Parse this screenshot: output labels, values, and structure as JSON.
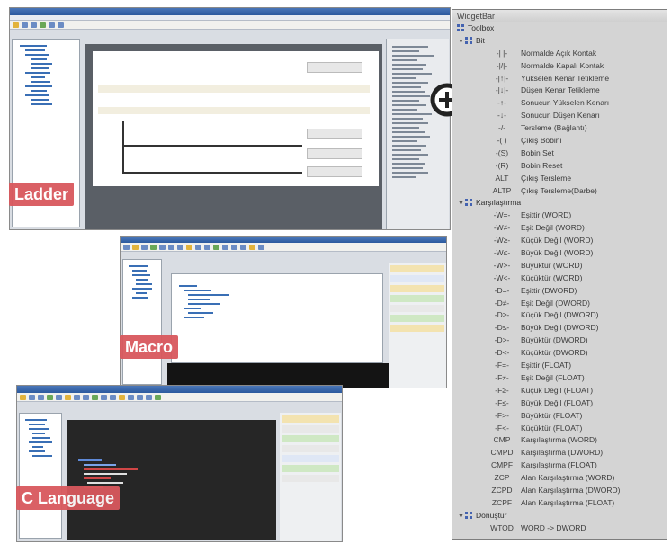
{
  "labels": {
    "ladder": "Ladder",
    "macro": "Macro",
    "c_language": "C Language"
  },
  "widgetbar": {
    "title": "WidgetBar",
    "toolbox_label": "Toolbox",
    "sections": [
      {
        "label": "Bit",
        "items": [
          {
            "sym": "-| |-",
            "desc": "Normalde Açık Kontak"
          },
          {
            "sym": "-|/|-",
            "desc": "Normalde Kapalı Kontak"
          },
          {
            "sym": "-|↑|-",
            "desc": "Yükselen Kenar Tetikleme"
          },
          {
            "sym": "-|↓|-",
            "desc": "Düşen Kenar Tetikleme"
          },
          {
            "sym": "-↑-",
            "desc": "Sonucun Yükselen Kenarı"
          },
          {
            "sym": "-↓-",
            "desc": "Sonucun Düşen Kenarı"
          },
          {
            "sym": "-/-",
            "desc": "Tersleme (Bağlantı)"
          },
          {
            "sym": "-( )",
            "desc": "Çıkış Bobini"
          },
          {
            "sym": "-(S)",
            "desc": "Bobin Set"
          },
          {
            "sym": "-(R)",
            "desc": "Bobin Reset"
          },
          {
            "sym": "ALT",
            "desc": "Çıkış Tersleme"
          },
          {
            "sym": "ALTP",
            "desc": "Çıkış Tersleme(Darbe)"
          }
        ]
      },
      {
        "label": "Karşılaştırma",
        "items": [
          {
            "sym": "-W=-",
            "desc": "Eşittir (WORD)"
          },
          {
            "sym": "-W≠-",
            "desc": "Eşit Değil (WORD)"
          },
          {
            "sym": "-W≥-",
            "desc": "Küçük Değil (WORD)"
          },
          {
            "sym": "-W≤-",
            "desc": "Büyük Değil (WORD)"
          },
          {
            "sym": "-W>-",
            "desc": "Büyüktür (WORD)"
          },
          {
            "sym": "-W<-",
            "desc": "Küçüktür (WORD)"
          },
          {
            "sym": "-D=-",
            "desc": "Eşittir (DWORD)"
          },
          {
            "sym": "-D≠-",
            "desc": "Eşit Değil (DWORD)"
          },
          {
            "sym": "-D≥-",
            "desc": "Küçük Değil (DWORD)"
          },
          {
            "sym": "-D≤-",
            "desc": "Büyük Değil (DWORD)"
          },
          {
            "sym": "-D>-",
            "desc": "Büyüktür (DWORD)"
          },
          {
            "sym": "-D<-",
            "desc": "Küçüktür (DWORD)"
          },
          {
            "sym": "-F=-",
            "desc": "Eşittir (FLOAT)"
          },
          {
            "sym": "-F≠-",
            "desc": "Eşit Değil (FLOAT)"
          },
          {
            "sym": "-F≥-",
            "desc": "Küçük Değil (FLOAT)"
          },
          {
            "sym": "-F≤-",
            "desc": "Büyük Değil (FLOAT)"
          },
          {
            "sym": "-F>-",
            "desc": "Büyüktür (FLOAT)"
          },
          {
            "sym": "-F<-",
            "desc": "Küçüktür (FLOAT)"
          },
          {
            "sym": "CMP",
            "desc": "Karşılaştırma (WORD)"
          },
          {
            "sym": "CMPD",
            "desc": "Karşılaştırma (DWORD)"
          },
          {
            "sym": "CMPF",
            "desc": "Karşılaştırma (FLOAT)"
          },
          {
            "sym": "ZCP",
            "desc": "Alan Karşılaştırma (WORD)"
          },
          {
            "sym": "ZCPD",
            "desc": "Alan Karşılaştırma (DWORD)"
          },
          {
            "sym": "ZCPF",
            "desc": "Alan Karşılaştırma (FLOAT)"
          }
        ]
      },
      {
        "label": "Dönüştür",
        "items": [
          {
            "sym": "WTOD",
            "desc": "WORD -> DWORD"
          }
        ]
      }
    ]
  }
}
